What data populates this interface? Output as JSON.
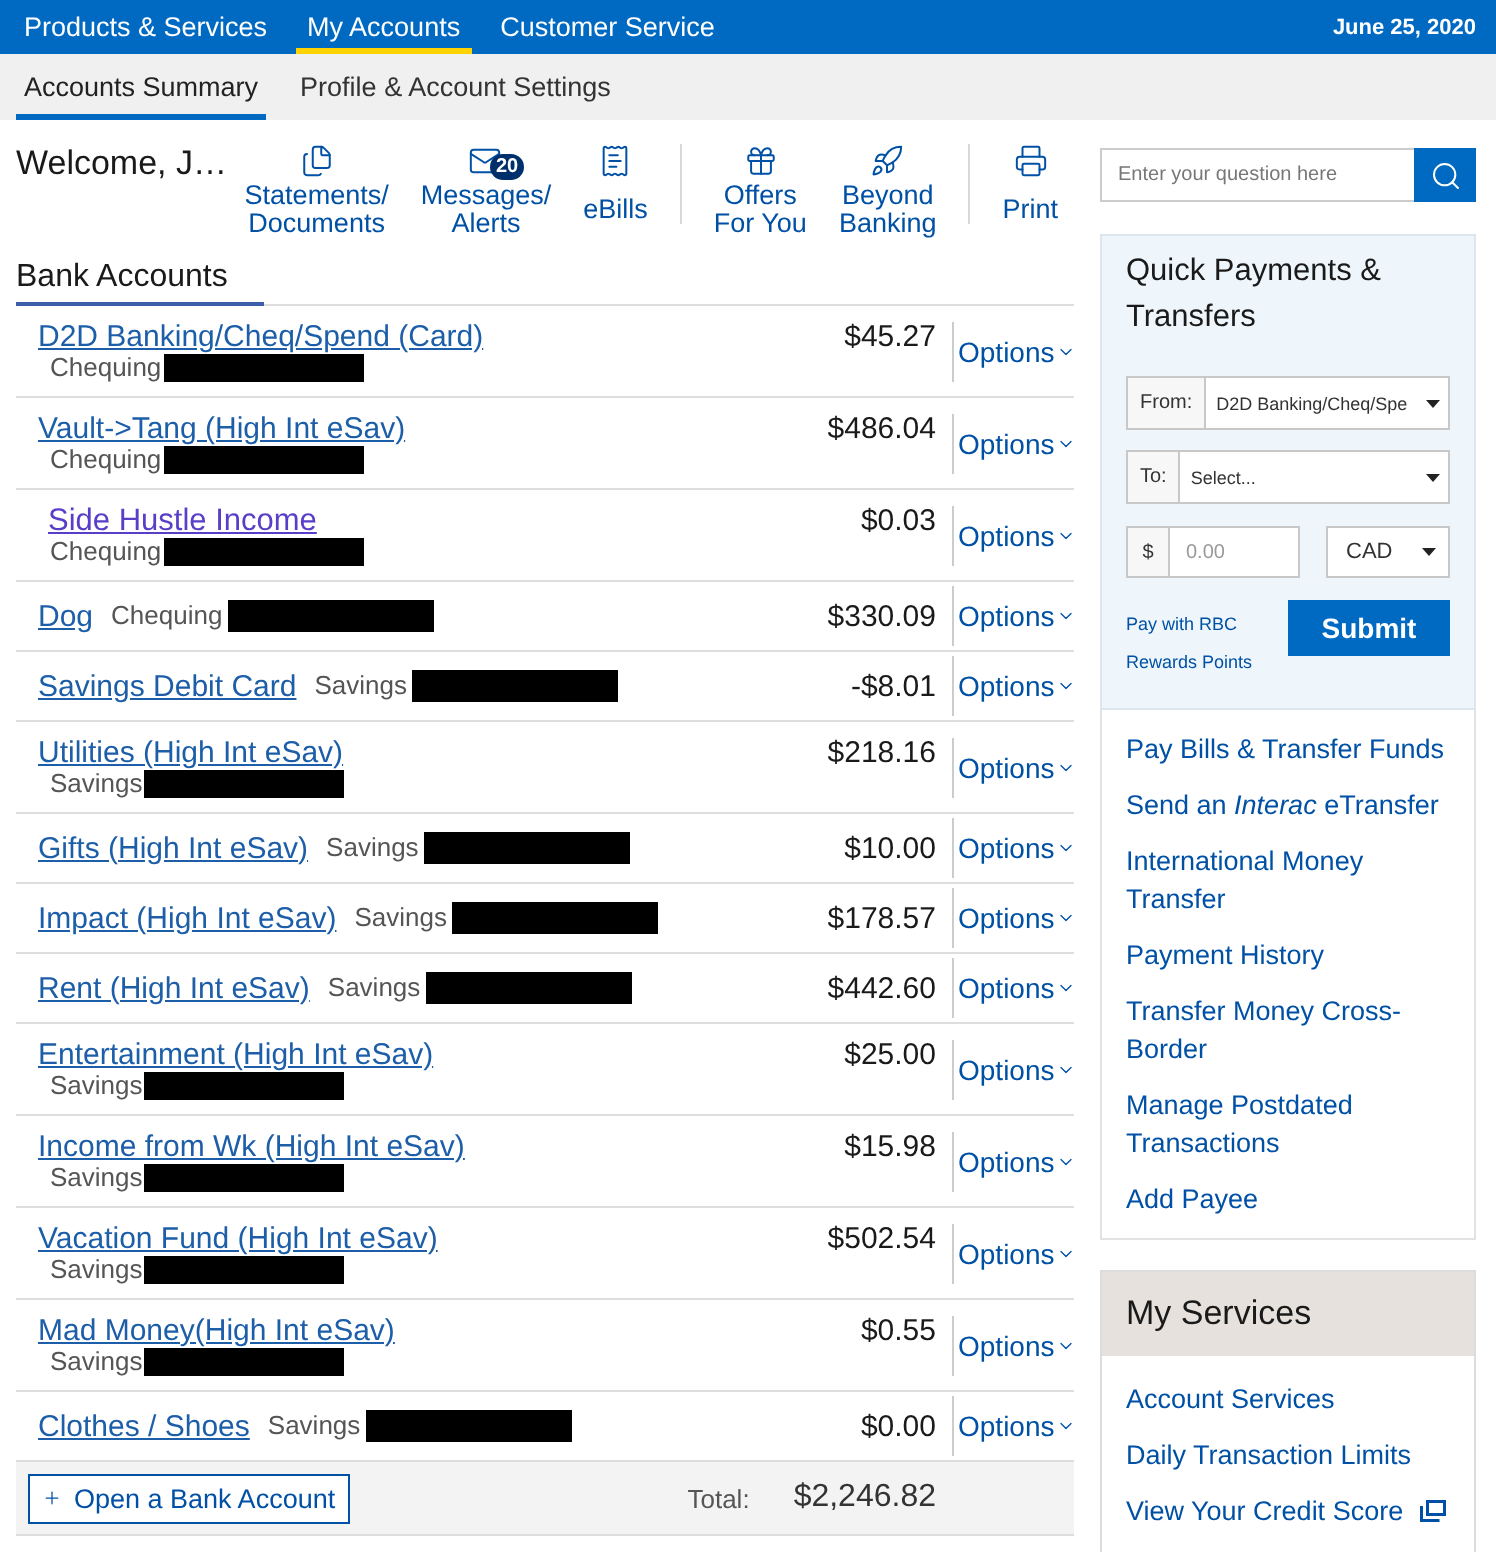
{
  "top_nav": {
    "items": [
      {
        "label": "Products & Services",
        "selected": false
      },
      {
        "label": "My Accounts",
        "selected": true
      },
      {
        "label": "Customer Service",
        "selected": false
      }
    ],
    "date": "June 25, 2020"
  },
  "sub_nav": {
    "tabs": [
      {
        "label": "Accounts Summary",
        "selected": true
      },
      {
        "label": "Profile & Account Settings",
        "selected": false
      }
    ]
  },
  "welcome": "Welcome, J…",
  "shortcut_groups": [
    [
      {
        "kind": "statements",
        "lines": [
          "Statements/",
          "Documents"
        ]
      },
      {
        "kind": "messages",
        "lines": [
          "Messages/",
          "Alerts"
        ],
        "badge": "20"
      },
      {
        "kind": "ebills",
        "lines": [
          "eBills"
        ]
      }
    ],
    [
      {
        "kind": "offers",
        "lines": [
          "Offers",
          "For You"
        ]
      },
      {
        "kind": "beyond",
        "lines": [
          "Beyond",
          "Banking"
        ]
      }
    ],
    [
      {
        "kind": "print",
        "lines": [
          "Print"
        ]
      }
    ]
  ],
  "bank_accounts": {
    "title": "Bank Accounts",
    "rows": [
      {
        "name": "D2D Banking/Cheq/Spend (Card)",
        "type": "Chequing",
        "amount": "$45.27",
        "kind": "stacked",
        "visited": false,
        "options": "Options"
      },
      {
        "name": "Vault->Tang (High Int eSav)",
        "type": "Chequing",
        "amount": "$486.04",
        "kind": "stacked",
        "visited": false,
        "options": "Options"
      },
      {
        "name": "Side Hustle Income",
        "type": "Chequing",
        "amount": "$0.03",
        "kind": "stacked",
        "visited": true,
        "options": "Options"
      },
      {
        "name": "Dog",
        "type": "Chequing",
        "amount": "$330.09",
        "kind": "inline",
        "visited": false,
        "options": "Options"
      },
      {
        "name": "Savings Debit Card",
        "type": "Savings",
        "amount": "-$8.01",
        "kind": "inline",
        "visited": false,
        "options": "Options"
      },
      {
        "name": "Utilities (High Int eSav)",
        "type": "Savings",
        "amount": "$218.16",
        "kind": "stacked",
        "visited": false,
        "options": "Options"
      },
      {
        "name": "Gifts (High Int eSav)",
        "type": "Savings",
        "amount": "$10.00",
        "kind": "inline",
        "visited": false,
        "options": "Options"
      },
      {
        "name": "Impact (High Int eSav)",
        "type": "Savings",
        "amount": "$178.57",
        "kind": "inline",
        "visited": false,
        "options": "Options"
      },
      {
        "name": "Rent (High Int eSav)",
        "type": "Savings",
        "amount": "$442.60",
        "kind": "inline",
        "visited": false,
        "options": "Options"
      },
      {
        "name": "Entertainment (High Int eSav)",
        "type": "Savings",
        "amount": "$25.00",
        "kind": "stacked",
        "visited": false,
        "options": "Options"
      },
      {
        "name": "Income from Wk (High Int eSav)",
        "type": "Savings",
        "amount": "$15.98",
        "kind": "stacked",
        "visited": false,
        "options": "Options"
      },
      {
        "name": "Vacation Fund (High Int eSav)",
        "type": "Savings",
        "amount": "$502.54",
        "kind": "stacked",
        "visited": false,
        "options": "Options"
      },
      {
        "name": "Mad Money(High Int eSav)",
        "type": "Savings",
        "amount": "$0.55",
        "kind": "stacked",
        "visited": false,
        "options": "Options"
      },
      {
        "name": "Clothes / Shoes",
        "type": "Savings",
        "amount": "$0.00",
        "kind": "inline",
        "visited": false,
        "options": "Options"
      }
    ],
    "open_account_button": "Open a Bank Account",
    "total_label": "Total:",
    "total": "$2,246.82"
  },
  "search": {
    "placeholder": "Enter your question here"
  },
  "quick_payments": {
    "title": "Quick Payments & Transfers",
    "from": {
      "label": "From:",
      "value": "D2D Banking/Cheq/Spe"
    },
    "to": {
      "label": "To:",
      "value": "Select..."
    },
    "amount": {
      "prefix": "$",
      "placeholder": "0.00"
    },
    "currency": "CAD",
    "rewards_link": "Pay with RBC Rewards Points",
    "submit": "Submit"
  },
  "payment_links": [
    "Pay Bills & Transfer Funds",
    "Send an *Interac* eTransfer",
    "International Money Transfer",
    "Payment History",
    "Transfer Money Cross-Border",
    "Manage Postdated Transactions",
    "Add Payee"
  ],
  "my_services": {
    "title": "My Services",
    "links": [
      {
        "label": "Account Services",
        "external": false
      },
      {
        "label": "Daily Transaction Limits",
        "external": false
      },
      {
        "label": "View Your Credit Score",
        "external": true
      }
    ]
  }
}
